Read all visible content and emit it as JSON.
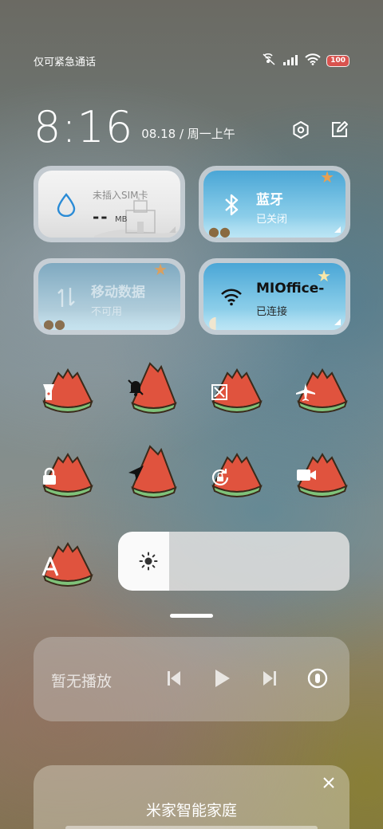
{
  "status_bar": {
    "carrier": "仅可紧急通话",
    "battery": "100",
    "icons": [
      "hands-free-icon",
      "signal-icon",
      "wifi-icon",
      "battery-icon"
    ]
  },
  "header": {
    "time": "8:16",
    "date": "08.18 / 周一上午",
    "actions": [
      "settings-icon",
      "edit-icon"
    ]
  },
  "tiles": {
    "data_usage": {
      "label": "未插入SIM卡",
      "value": "--",
      "unit": "MB",
      "icon": "water-drop-icon"
    },
    "bluetooth": {
      "title": "蓝牙",
      "status": "已关闭",
      "icon": "bluetooth-icon"
    },
    "mobile_data": {
      "title": "移动数据",
      "status": "不可用",
      "icon": "mobile-data-icon"
    },
    "wifi": {
      "title": "MIOffice-",
      "status": "已连接",
      "icon": "wifi-icon"
    }
  },
  "toggles": [
    {
      "name": "flashlight",
      "icon": "flashlight-icon"
    },
    {
      "name": "silent",
      "icon": "bell-off-icon"
    },
    {
      "name": "screenshot",
      "icon": "screenshot-icon"
    },
    {
      "name": "airplane",
      "icon": "airplane-icon"
    },
    {
      "name": "lock-screen",
      "icon": "lock-icon"
    },
    {
      "name": "location",
      "icon": "location-arrow-icon"
    },
    {
      "name": "rotation-lock",
      "icon": "rotation-lock-icon"
    },
    {
      "name": "screen-record",
      "icon": "video-camera-icon"
    },
    {
      "name": "auto-brightness",
      "icon": "letter-a-icon"
    }
  ],
  "brightness": {
    "level": 0.22,
    "icon": "sun-icon"
  },
  "media": {
    "status": "暂无播放",
    "controls": [
      "previous-icon",
      "play-icon",
      "next-icon",
      "cast-icon"
    ]
  },
  "smart_home": {
    "title": "米家智能家庭",
    "icon": "close-icon"
  },
  "colors": {
    "melon_red": "#e0533e",
    "melon_rind": "#7fc27a",
    "tile_sky": "#4aa6d6",
    "accent_blue": "#2a8bd6"
  }
}
